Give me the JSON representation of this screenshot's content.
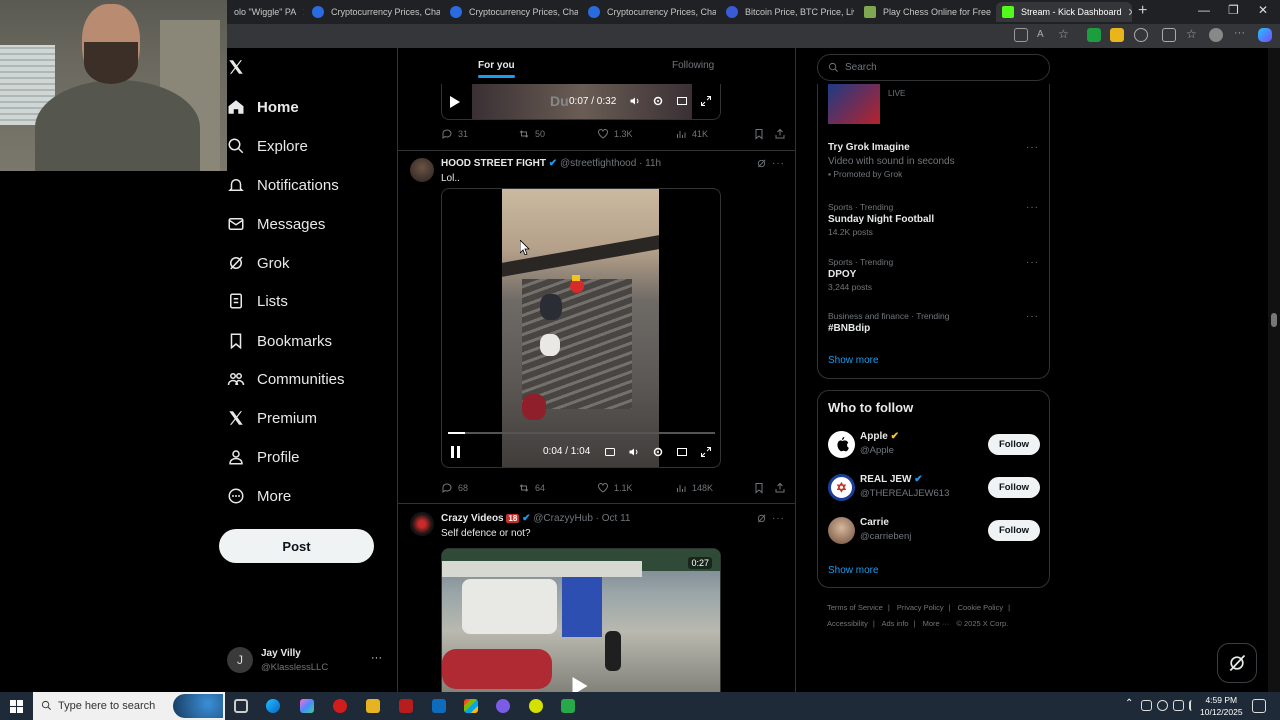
{
  "browser": {
    "tabs": [
      {
        "label": "olo \"Wiggle\" PA",
        "active": false
      },
      {
        "label": "Cryptocurrency Prices, Char",
        "active": false
      },
      {
        "label": "Cryptocurrency Prices, Char",
        "active": false
      },
      {
        "label": "Cryptocurrency Prices, Char",
        "active": false
      },
      {
        "label": "Bitcoin Price, BTC Price, Live",
        "active": false
      },
      {
        "label": "Play Chess Online for Free",
        "active": false
      },
      {
        "label": "Stream - Kick Dashboard",
        "active": true
      }
    ],
    "new_tab": "+",
    "minimize": "—",
    "maximize": "❐",
    "close": "✕"
  },
  "sidebar": {
    "logo": "X",
    "items": [
      {
        "label": "Home",
        "icon": "home-icon"
      },
      {
        "label": "Explore",
        "icon": "search-icon"
      },
      {
        "label": "Notifications",
        "icon": "bell-icon"
      },
      {
        "label": "Messages",
        "icon": "mail-icon"
      },
      {
        "label": "Grok",
        "icon": "grok-icon"
      },
      {
        "label": "Lists",
        "icon": "list-icon"
      },
      {
        "label": "Bookmarks",
        "icon": "bookmark-icon"
      },
      {
        "label": "Communities",
        "icon": "people-icon"
      },
      {
        "label": "Premium",
        "icon": "x-icon"
      },
      {
        "label": "Profile",
        "icon": "person-icon"
      },
      {
        "label": "More",
        "icon": "more-circle-icon"
      }
    ],
    "post_label": "Post",
    "account": {
      "name": "Jay Villy",
      "handle": "@KlasslessLLC",
      "initial": "J",
      "menu": "···"
    }
  },
  "timeline": {
    "tabs": [
      {
        "label": "For you",
        "active": true
      },
      {
        "label": "Following",
        "active": false
      }
    ],
    "prev_tweet": {
      "video_time": "0:07 / 0:32",
      "video_overlay": "Du",
      "replies": "31",
      "reposts": "50",
      "likes": "1.3K",
      "views": "41K"
    },
    "tweets": [
      {
        "name": "HOOD STREET FIGHT",
        "handle": "@streetfighthood",
        "time": "· 11h",
        "text": "Lol..",
        "video_time": "0:04 / 1:04",
        "replies": "68",
        "reposts": "64",
        "likes": "1.1K",
        "views": "148K"
      },
      {
        "name": "Crazy Videos",
        "badge": "18",
        "handle": "@CrazyyHub",
        "time": "· Oct 11",
        "text": "Self defence or not?",
        "duration": "0:27"
      }
    ]
  },
  "right": {
    "search_placeholder": "Search",
    "live_badge": "LIVE",
    "trends": [
      {
        "category": "",
        "title": "Try Grok Imagine",
        "count": "Video with sound in seconds",
        "promoted": "Promoted by Grok"
      },
      {
        "category": "Sports · Trending",
        "title": "Sunday Night Football",
        "count": "14.2K posts"
      },
      {
        "category": "Sports · Trending",
        "title": "DPOY",
        "count": "3,244 posts"
      },
      {
        "category": "Business and finance · Trending",
        "title": "#BNBdip",
        "count": ""
      }
    ],
    "show_more": "Show more",
    "who_to_follow": {
      "title": "Who to follow",
      "accounts": [
        {
          "name": "Apple",
          "handle": "@Apple",
          "verified": "gold"
        },
        {
          "name": "REAL JEW",
          "handle": "@THEREALJEW613",
          "verified": "blue"
        },
        {
          "name": "Carrie",
          "handle": "@carriebenj",
          "verified": "none"
        }
      ],
      "follow_label": "Follow",
      "show_more": "Show more"
    },
    "footer": [
      "Terms of Service",
      "|",
      "Privacy Policy",
      "|",
      "Cookie Policy",
      "|",
      "Accessibility",
      "|",
      "Ads info",
      "|",
      "More ···",
      "© 2025 X Corp."
    ]
  },
  "taskbar": {
    "search_placeholder": "Type here to search",
    "time": "4:59 PM",
    "date": "10/12/2025"
  },
  "colors": {
    "accent": "#1d9bf0",
    "gold": "#f4c430",
    "kick_green": "#53fc18"
  }
}
